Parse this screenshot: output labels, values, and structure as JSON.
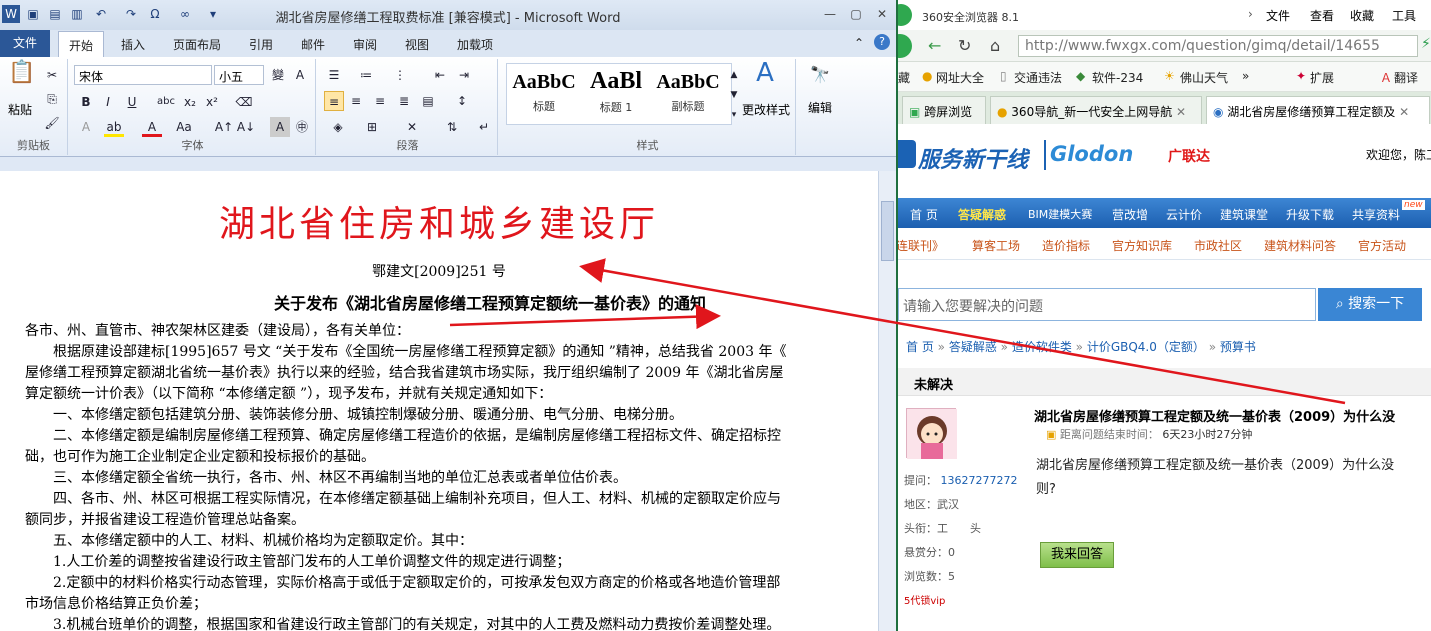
{
  "word": {
    "title": "湖北省房屋修缮工程取费标准 [兼容模式] - Microsoft Word",
    "tabs": [
      "文件",
      "开始",
      "插入",
      "页面布局",
      "引用",
      "邮件",
      "审阅",
      "视图",
      "加载项"
    ],
    "font_name": "宋体",
    "font_size": "小五",
    "paste_label": "粘贴",
    "group_labels": [
      "剪贴板",
      "字体",
      "段落",
      "样式"
    ],
    "styles": [
      {
        "preview": "AaBbC",
        "label": "标题"
      },
      {
        "preview": "AaBl",
        "label": "标题 1"
      },
      {
        "preview": "AaBbC",
        "label": "副标题"
      }
    ],
    "change_styles": "更改样式",
    "edit_label": "编辑",
    "doc": {
      "header": "湖北省住房和城乡建设厅",
      "doc_number": "鄂建文[2009]251 号",
      "title": "关于发布《湖北省房屋修缮工程预算定额统一基价表》的通知",
      "paragraphs": [
        "各市、州、直管市、神农架林区建委（建设局），各有关单位：",
        "　　根据原建设部建标[1995]657 号文 “关于发布《全国统一房屋修缮工程预算定额》的通知 ”精神，总结我省 2003 年《",
        "屋修缮工程预算定额湖北省统一基价表》执行以来的经验，结合我省建筑市场实际，我厅组织编制了 2009 年《湖北省房屋",
        "算定额统一计价表》（以下简称 “本修缮定额 ”），现予发布，并就有关规定通知如下：",
        "　　一、本修缮定额包括建筑分册、装饰装修分册、城镇控制爆破分册、暖通分册、电气分册、电梯分册。",
        "　　二、本修缮定额是编制房屋修缮工程预算、确定房屋修缮工程造价的依据，是编制房屋修缮工程招标文件、确定招标控",
        "础，也可作为施工企业制定企业定额和投标报价的基础。",
        "　　三、本修缮定额全省统一执行，各市、州、林区不再编制当地的单位汇总表或者单位估价表。",
        "　　四、各市、州、林区可根据工程实际情况，在本修缮定额基础上编制补充项目，但人工、材料、机械的定额取定价应与",
        "额同步，并报省建设工程造价管理总站备案。",
        "　　五、本修缮定额中的人工、材料、机械价格均为定额取定价。其中：",
        "　　1.人工价差的调整按省建设行政主管部门发布的人工单价调整文件的规定进行调整；",
        "　　2.定额中的材料价格实行动态管理，实际价格高于或低于定额取定价的，可按承发包双方商定的价格或各地造价管理部",
        "市场信息价格结算正负价差；",
        "　　3.机械台班单价的调整，根据国家和省建设行政主管部门的有关规定，对其中的人工费及燃料动力费按价差调整处理。"
      ]
    }
  },
  "browser": {
    "app_name": "360安全浏览器 8.1",
    "menu": [
      "文件",
      "查看",
      "收藏",
      "工具"
    ],
    "url": "http://www.fwxgx.com/question/gimq/detail/14655",
    "bookmarks_prefix": "藏",
    "bookmarks": [
      "网址大全",
      "交通违法",
      "软件-234",
      "佛山天气"
    ],
    "ext_label": "扩展",
    "translate_label": "翻译",
    "tabs": [
      "跨屏浏览",
      "360导航_新一代安全上网导航",
      "湖北省房屋修缮预算工程定额及"
    ],
    "site": {
      "logo_main": "服务新干线",
      "logo_brand": "Glodon",
      "logo_cn": "广联达",
      "welcome": "欢迎您，陈工",
      "nav_main": [
        "首 页",
        "答疑解惑",
        "BIM建模大赛",
        "营改增",
        "云计价",
        "建筑课堂",
        "升级下载",
        "共享资料"
      ],
      "nav_badge": "new",
      "nav_sub": [
        "连联刊》",
        "算客工场",
        "造价指标",
        "官方知识库",
        "市政社区",
        "建筑材料问答",
        "官方活动"
      ],
      "search_placeholder": "请输入您要解决的问题",
      "search_button": "搜索一下",
      "breadcrumb": [
        "首 页",
        "答疑解惑",
        "造价软件类",
        "计价GBQ4.0（定额）",
        "预算书"
      ],
      "section": "未解决",
      "question_title": "湖北省房屋修缮预算工程定额及统一基价表（2009）为什么没",
      "time_label": "距离问题结束时间：",
      "time_value": "6天23小时27分钟",
      "question_body_1": "湖北省房屋修缮预算工程定额及统一基价表（2009）为什么没",
      "question_body_2": "则?",
      "asker_label": "提问：",
      "asker": "13627277272",
      "region_label": "地区：",
      "region": "武汉",
      "rank_label": "头衔：",
      "rank": "工　　头",
      "reward_label": "悬赏分：",
      "reward": "0",
      "views_label": "浏览数：",
      "views": "5",
      "vip": "5代锁vip",
      "answer_button": "我来回答"
    }
  },
  "colors": {
    "annotation_red": "#e0161c",
    "word_blue": "#2b5797",
    "site_blue": "#1c5fb0"
  }
}
